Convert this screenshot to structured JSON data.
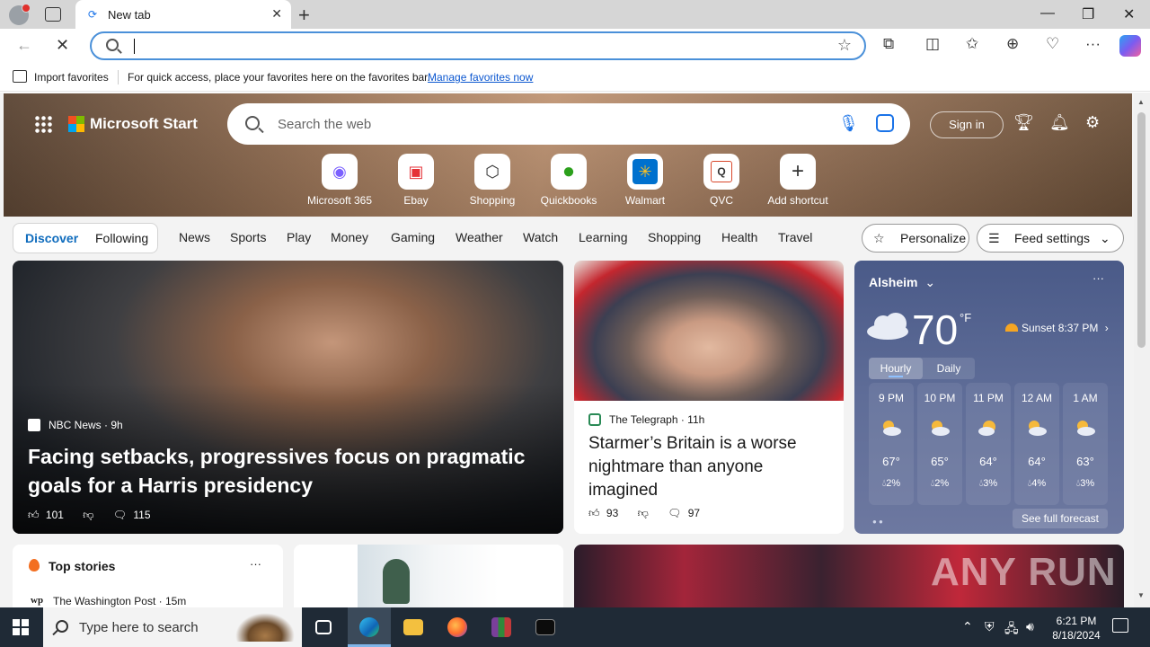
{
  "browser": {
    "tab_title": "New tab",
    "omnibox_value": "",
    "favorites_bar": {
      "import_label": "Import favorites",
      "hint": "For quick access, place your favorites here on the favorites bar.",
      "manage_link": "Manage favorites now"
    }
  },
  "header": {
    "brand": "Microsoft Start",
    "search_placeholder": "Search the web",
    "sign_in": "Sign in"
  },
  "shortcuts": [
    {
      "label": "Microsoft 365",
      "icon": "microsoft365-icon"
    },
    {
      "label": "Ebay",
      "icon": "ebay-icon"
    },
    {
      "label": "Shopping",
      "icon": "shopping-tag-icon"
    },
    {
      "label": "Quickbooks",
      "icon": "quickbooks-icon"
    },
    {
      "label": "Walmart",
      "icon": "walmart-icon"
    },
    {
      "label": "QVC",
      "icon": "qvc-icon"
    },
    {
      "label": "Add shortcut",
      "icon": "plus-icon"
    }
  ],
  "feed_nav": {
    "discover": "Discover",
    "following": "Following",
    "links": [
      "News",
      "Sports",
      "Play",
      "Money",
      "Gaming",
      "Weather",
      "Watch",
      "Learning",
      "Shopping",
      "Health",
      "Travel"
    ],
    "personalize": "Personalize",
    "feed_settings": "Feed settings"
  },
  "main_story": {
    "source": "NBC News · 9h",
    "title": "Facing setbacks, progressives focus on pragmatic goals for a Harris presidency",
    "likes": "101",
    "comments": "115"
  },
  "second_story": {
    "source": "The Telegraph",
    "age": "11h",
    "title": "Starmer’s Britain is a worse nightmare than anyone imagined",
    "likes": "93",
    "comments": "97"
  },
  "weather": {
    "location": "Alsheim",
    "temp": "70",
    "unit": "°F",
    "sunset": "Sunset 8:37 PM",
    "tab_hourly": "Hourly",
    "tab_daily": "Daily",
    "hours": [
      {
        "time": "9 PM",
        "temp": "67°",
        "rain": "2%"
      },
      {
        "time": "10 PM",
        "temp": "65°",
        "rain": "2%"
      },
      {
        "time": "11 PM",
        "temp": "64°",
        "rain": "3%"
      },
      {
        "time": "12 AM",
        "temp": "64°",
        "rain": "4%"
      },
      {
        "time": "1 AM",
        "temp": "63°",
        "rain": "3%"
      }
    ],
    "see_full": "See full forecast"
  },
  "top_stories": {
    "title": "Top stories",
    "source": "The Washington Post · 15m",
    "source_abbr": "wp"
  },
  "watermark": "ANY RUN",
  "taskbar": {
    "search_placeholder": "Type here to search",
    "time": "6:21 PM",
    "date": "8/18/2024"
  }
}
